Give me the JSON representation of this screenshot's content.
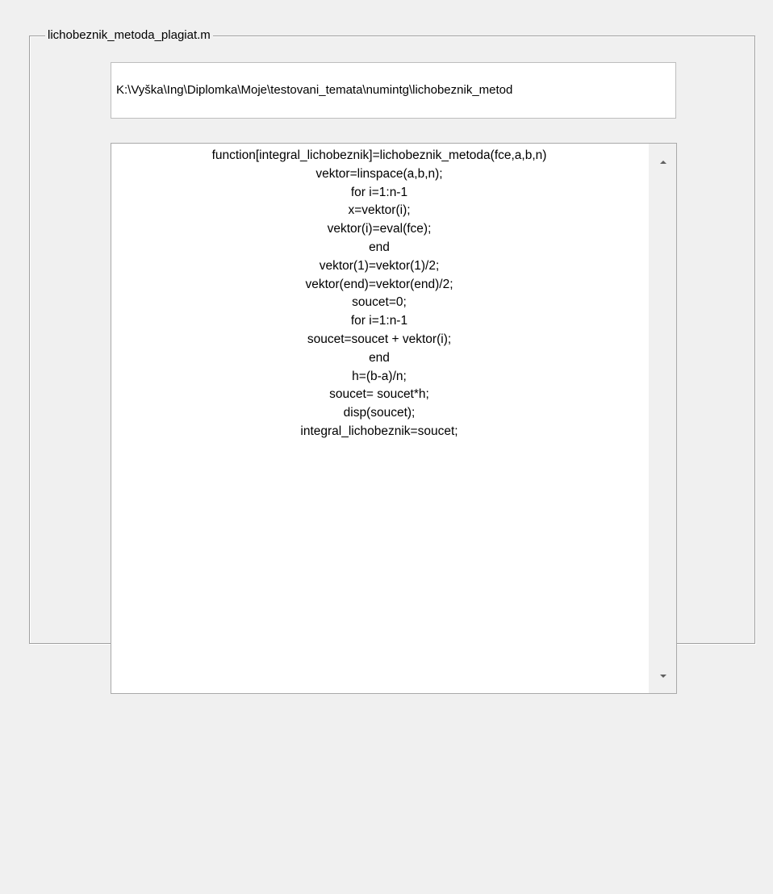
{
  "groupbox": {
    "title": "lichobeznik_metoda_plagiat.m"
  },
  "path_field": {
    "value": "K:\\Vyška\\Ing\\Diplomka\\Moje\\testovani_temata\\numintg\\lichobeznik_metod"
  },
  "code": {
    "lines": [
      "function[integral_lichobeznik]=lichobeznik_metoda(fce,a,b,n)",
      "vektor=linspace(a,b,n);",
      "for i=1:n-1",
      "x=vektor(i);",
      "vektor(i)=eval(fce);",
      "end",
      "vektor(1)=vektor(1)/2;",
      "vektor(end)=vektor(end)/2;",
      "soucet=0;",
      "for i=1:n-1",
      "soucet=soucet + vektor(i);",
      "end",
      "h=(b-a)/n;",
      "soucet= soucet*h;",
      "disp(soucet);",
      "integral_lichobeznik=soucet;"
    ]
  },
  "scrollbar": {
    "up_icon": "arrow-up-icon",
    "down_icon": "arrow-down-icon"
  }
}
